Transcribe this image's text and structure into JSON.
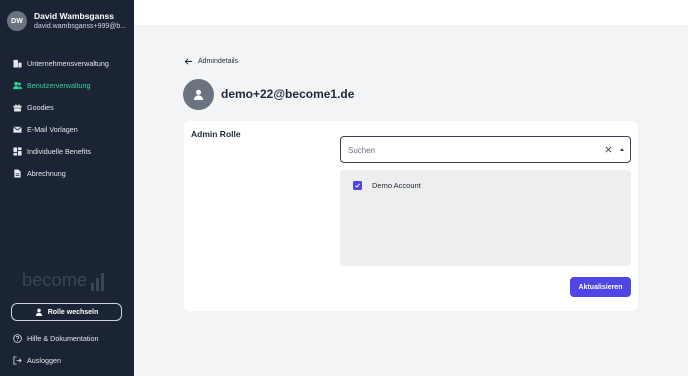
{
  "user": {
    "initials": "DW",
    "name": "David Wambsganss",
    "email": "david.wambsganss+999@b..."
  },
  "nav": {
    "items": [
      {
        "label": "Unternehmensverwaltung",
        "icon": "company-icon",
        "active": false
      },
      {
        "label": "Benutzerverwaltung",
        "icon": "users-icon",
        "active": true
      },
      {
        "label": "Goodies",
        "icon": "gift-icon",
        "active": false
      },
      {
        "label": "E-Mail Vorlagen",
        "icon": "mail-icon",
        "active": false
      },
      {
        "label": "Individuelle Benefits",
        "icon": "grid-icon",
        "active": false
      },
      {
        "label": "Abrechnung",
        "icon": "document-icon",
        "active": false
      }
    ]
  },
  "brand": {
    "logo_text": "become"
  },
  "sidebar_footer": {
    "switch_role_label": "Rolle wechseln",
    "help_label": "Hilfe & Dokumentation",
    "logout_label": "Ausloggen"
  },
  "main": {
    "back_label": "Admindetails",
    "title": "demo+22@become1.de",
    "section_label": "Admin Rolle",
    "search": {
      "placeholder": "Suchen",
      "value": ""
    },
    "options": [
      {
        "label": "Demo Account",
        "checked": true
      }
    ],
    "update_label": "Aktualisieren"
  },
  "colors": {
    "sidebar_bg": "#1b2434",
    "active_nav": "#34d399",
    "accent": "#4f46e5",
    "page_bg": "#f3f4f6"
  }
}
